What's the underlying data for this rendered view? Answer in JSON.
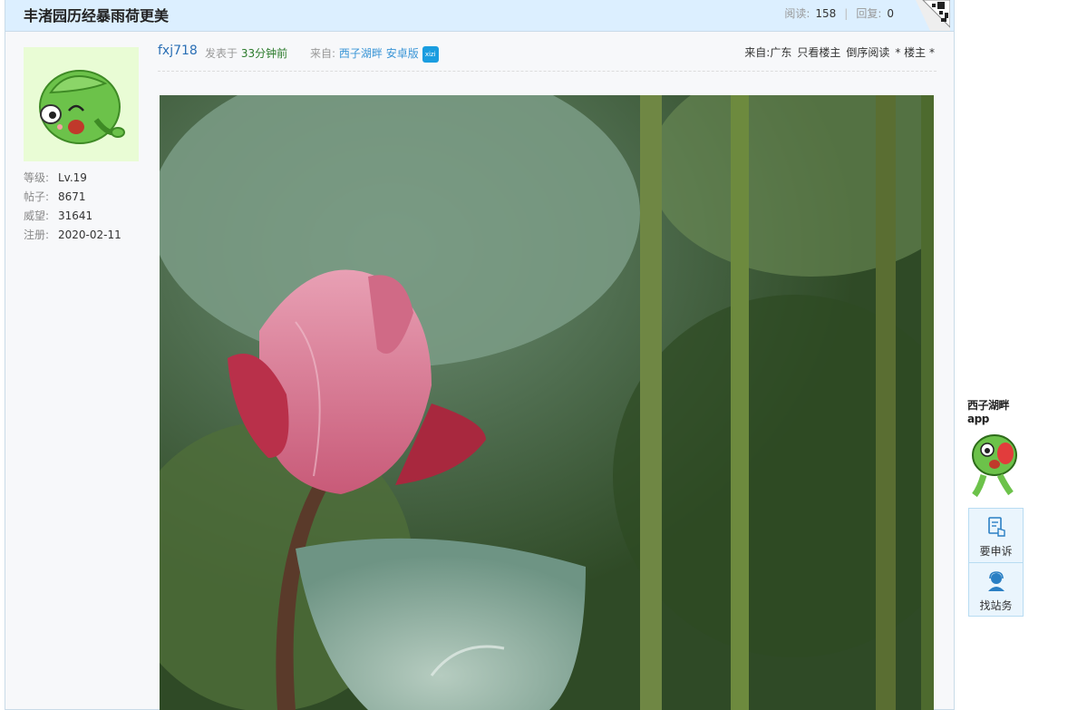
{
  "thread": {
    "title": "丰渚园历经暴雨荷更美",
    "read_label": "阅读:",
    "read_count": "158",
    "reply_label": "回复:",
    "reply_count": "0"
  },
  "author": {
    "level_label": "等级:",
    "level": "Lv.19",
    "posts_label": "帖子:",
    "posts": "8671",
    "prestige_label": "威望:",
    "prestige": "31641",
    "register_label": "注册:",
    "register": "2020-02-11"
  },
  "post": {
    "username": "fxj718",
    "posted_label": "发表于",
    "posted_time": "33分钟前",
    "from_label": "来自:",
    "from_source": "西子湖畔 安卓版",
    "badge_text": "xizi",
    "location": "来自:广东",
    "only_author": "只看楼主",
    "reverse_read": "倒序阅读",
    "floor": "* 楼主 *"
  },
  "sidebar": {
    "app_line1": "西子湖畔",
    "app_line2": "app",
    "complain_label": "要申诉",
    "service_label": "找站务"
  },
  "colors": {
    "title_bar": "#dcefff",
    "link_blue": "#2a6fb5",
    "source_blue": "#3a95d6",
    "time_green": "#2a7a2a",
    "frog_green": "#6cc24a"
  },
  "icons": {
    "avatar": "frog-mascot-icon",
    "qr": "qr-code-icon",
    "complain": "document-hand-icon",
    "service": "person-headset-icon"
  }
}
